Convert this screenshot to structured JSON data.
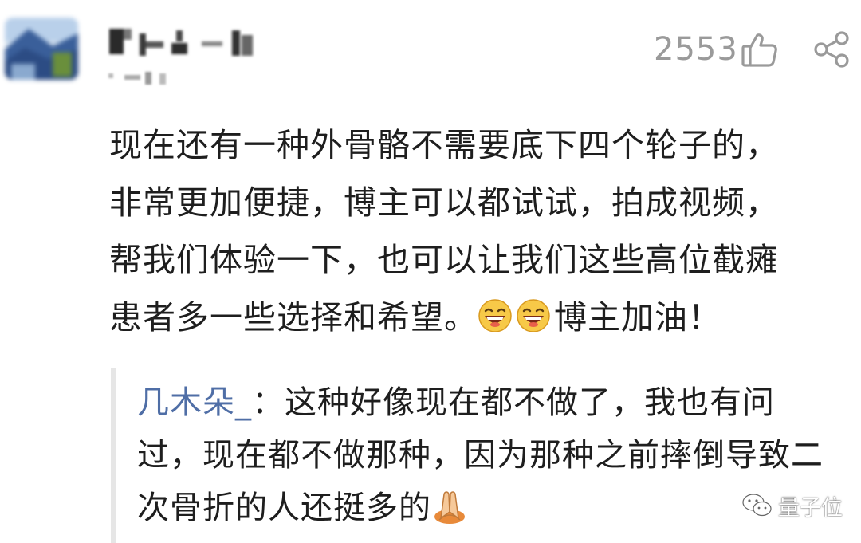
{
  "post": {
    "likes": "2553",
    "comment_lines": [
      "现在还有一种外骨骼不需要底下四个轮子的，",
      "非常更加便捷，博主可以都试试，拍成视频，",
      "帮我们体验一下，也可以让我们这些高位截瘫",
      "患者多一些选择和希望。",
      "博主加油！"
    ],
    "reply": {
      "author": "几木朵_",
      "separator": "：",
      "lines": [
        "这种好像现在都不做了，我也有问",
        "过，现在都不做那种，因为那种之前摔倒导致二",
        "次骨折的人还挺多的"
      ]
    }
  },
  "icons": {
    "like": "thumbs-up-icon",
    "share": "share-icon",
    "emoji": "grinning-face-icon",
    "reply_emoji": "clasped-hands-icon",
    "watermark": "wechat-icon"
  },
  "watermark": {
    "text": "量子位"
  },
  "colors": {
    "text": "#1e1e1e",
    "muted": "#9a9a9a",
    "reply_author": "#4f6ea6",
    "reply_bar": "#e6e6e6"
  }
}
